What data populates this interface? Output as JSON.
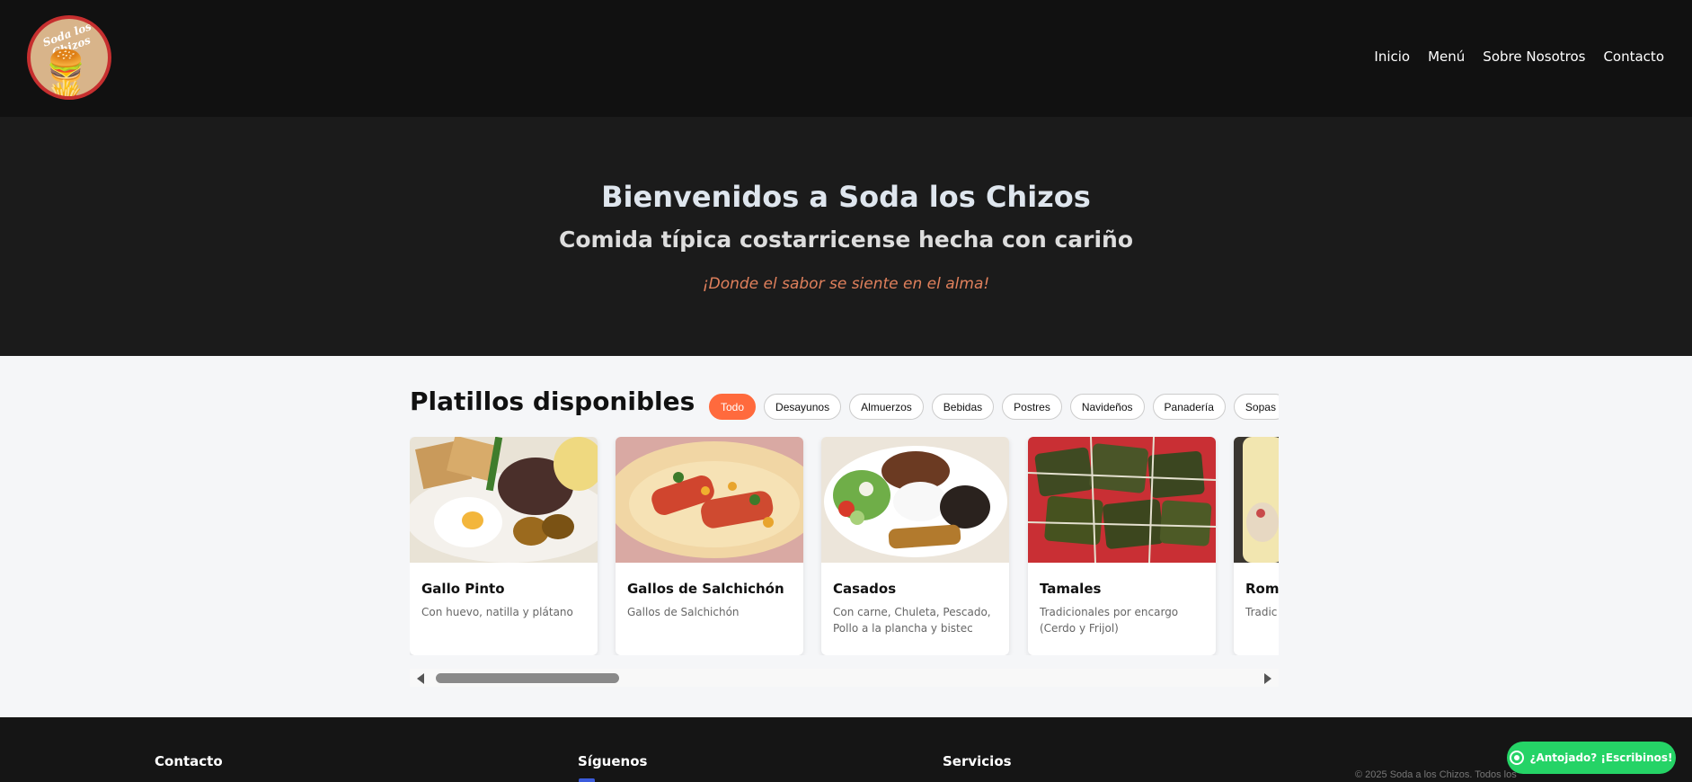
{
  "header": {
    "logo_text": "Soda los Chizos",
    "nav": [
      "Inicio",
      "Menú",
      "Sobre Nosotros",
      "Contacto"
    ]
  },
  "hero": {
    "title": "Bienvenidos a Soda los Chizos",
    "subtitle": "Comida típica costarricense hecha con cariño",
    "tagline": "¡Donde el sabor se siente en el alma!"
  },
  "menu": {
    "title": "Platillos disponibles",
    "filters": [
      "Todo",
      "Desayunos",
      "Almuerzos",
      "Bebidas",
      "Postres",
      "Navideños",
      "Panadería",
      "Sopas"
    ],
    "active_filter": "Todo",
    "cards": [
      {
        "title": "Gallo Pinto",
        "desc": "Con huevo, natilla y plátano"
      },
      {
        "title": "Gallos de Salchichón",
        "desc": "Gallos de Salchichón"
      },
      {
        "title": "Casados",
        "desc": "Con carne, Chuleta, Pescado, Pollo a la plancha y bistec"
      },
      {
        "title": "Tamales",
        "desc": "Tradicionales por encargo (Cerdo y Frijol)"
      },
      {
        "title": "Romp",
        "desc": "Tradic"
      }
    ]
  },
  "footer": {
    "col1": "Contacto",
    "col2": "Síguenos",
    "col3": "Servicios",
    "copyright": "© 2025 Soda a los Chizos. Todos los"
  },
  "whatsapp": {
    "label": "¿Antojado? ¡Escribinos!",
    "color": "#25d366"
  },
  "colors": {
    "accent": "#ff6a3d",
    "header_bg": "#111111",
    "hero_bg": "#1b1b1b"
  }
}
